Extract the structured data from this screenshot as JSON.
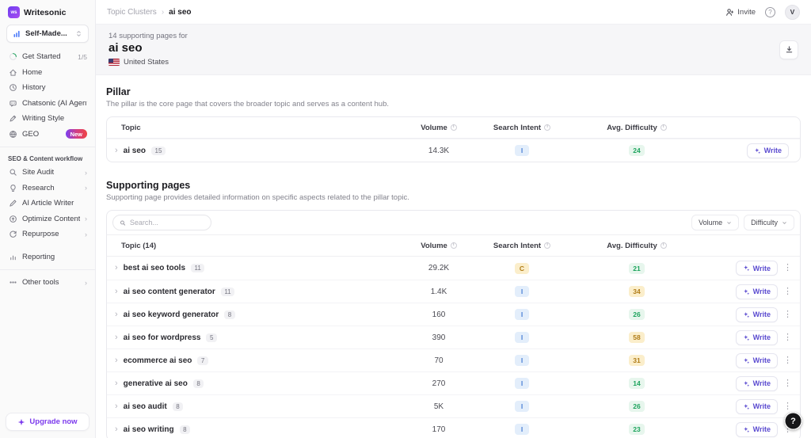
{
  "brand": {
    "name": "Writesonic",
    "logo_text": "ws"
  },
  "sidebar": {
    "workspace": {
      "name": "Self-Made..."
    },
    "nav": [
      {
        "icon": "progress-circle-icon",
        "label": "Get Started",
        "meta": "1/5"
      },
      {
        "icon": "home-icon",
        "label": "Home"
      },
      {
        "icon": "history-icon",
        "label": "History"
      },
      {
        "icon": "chat-icon",
        "label": "Chatsonic (AI Agent)"
      },
      {
        "icon": "pen-icon",
        "label": "Writing Style"
      },
      {
        "icon": "globe-icon",
        "label": "GEO",
        "badge": "New"
      }
    ],
    "section_label": "SEO & Content workflow",
    "workflow": [
      {
        "icon": "audit-icon",
        "label": "Site Audit",
        "chevron": "›"
      },
      {
        "icon": "lightbulb-icon",
        "label": "Research",
        "chevron": "›"
      },
      {
        "icon": "pencil-icon",
        "label": "AI Article Writer"
      },
      {
        "icon": "optimize-icon",
        "label": "Optimize Content",
        "chevron": "›"
      },
      {
        "icon": "refresh-icon",
        "label": "Repurpose",
        "chevron": "›"
      },
      {
        "icon": "bars-icon",
        "label": "Reporting"
      }
    ],
    "other_tools": {
      "label": "Other tools",
      "chevron": "›"
    },
    "upgrade_label": "Upgrade now"
  },
  "topbar": {
    "breadcrumb_parent": "Topic Clusters",
    "breadcrumb_sep": "›",
    "breadcrumb_current": "ai seo",
    "invite_label": "Invite",
    "help_label": "?",
    "avatar_initial": "V"
  },
  "hero": {
    "subtitle": "14 supporting pages for",
    "title": "ai seo",
    "country": "United States"
  },
  "pillar": {
    "heading": "Pillar",
    "description": "The pillar is the core page that covers the broader topic and serves as a content hub.",
    "columns": {
      "topic": "Topic",
      "volume": "Volume",
      "intent": "Search Intent",
      "difficulty": "Avg. Difficulty"
    },
    "row": {
      "topic": "ai seo",
      "count": "15",
      "volume": "14.3K",
      "intent": "I",
      "intent_color": "blue",
      "difficulty": "24",
      "difficulty_color": "green"
    },
    "write_label": "Write"
  },
  "supporting": {
    "heading": "Supporting pages",
    "description": "Supporting page provides detailed information on specific aspects related to the pillar topic.",
    "search_placeholder": "Search...",
    "filter_volume": "Volume",
    "filter_difficulty": "Difficulty",
    "columns": {
      "topic": "Topic (14)",
      "volume": "Volume",
      "intent": "Search Intent",
      "difficulty": "Avg. Difficulty"
    },
    "write_label": "Write",
    "kebab_glyph": "⋮",
    "rows": [
      {
        "topic": "best ai seo tools",
        "count": "11",
        "volume": "29.2K",
        "intent": "C",
        "intent_color": "amber",
        "difficulty": "21",
        "difficulty_color": "green"
      },
      {
        "topic": "ai seo content generator",
        "count": "11",
        "volume": "1.4K",
        "intent": "I",
        "intent_color": "blue",
        "difficulty": "34",
        "difficulty_color": "amber"
      },
      {
        "topic": "ai seo keyword generator",
        "count": "8",
        "volume": "160",
        "intent": "I",
        "intent_color": "blue",
        "difficulty": "26",
        "difficulty_color": "green"
      },
      {
        "topic": "ai seo for wordpress",
        "count": "5",
        "volume": "390",
        "intent": "I",
        "intent_color": "blue",
        "difficulty": "58",
        "difficulty_color": "amber"
      },
      {
        "topic": "ecommerce ai seo",
        "count": "7",
        "volume": "70",
        "intent": "I",
        "intent_color": "blue",
        "difficulty": "31",
        "difficulty_color": "amber"
      },
      {
        "topic": "generative ai seo",
        "count": "8",
        "volume": "270",
        "intent": "I",
        "intent_color": "blue",
        "difficulty": "14",
        "difficulty_color": "green"
      },
      {
        "topic": "ai seo audit",
        "count": "8",
        "volume": "5K",
        "intent": "I",
        "intent_color": "blue",
        "difficulty": "26",
        "difficulty_color": "green"
      },
      {
        "topic": "ai seo writing",
        "count": "8",
        "volume": "170",
        "intent": "I",
        "intent_color": "blue",
        "difficulty": "23",
        "difficulty_color": "green"
      }
    ]
  },
  "help_fab_label": "?",
  "colors": {
    "accent_purple": "#6246e5",
    "green_bg": "#e7f6ed",
    "green_tx": "#1ca35c",
    "amber_bg": "#fbeecb",
    "amber_tx": "#b07c17",
    "blue_bg": "#e3eefb",
    "blue_tx": "#4d82d6"
  }
}
